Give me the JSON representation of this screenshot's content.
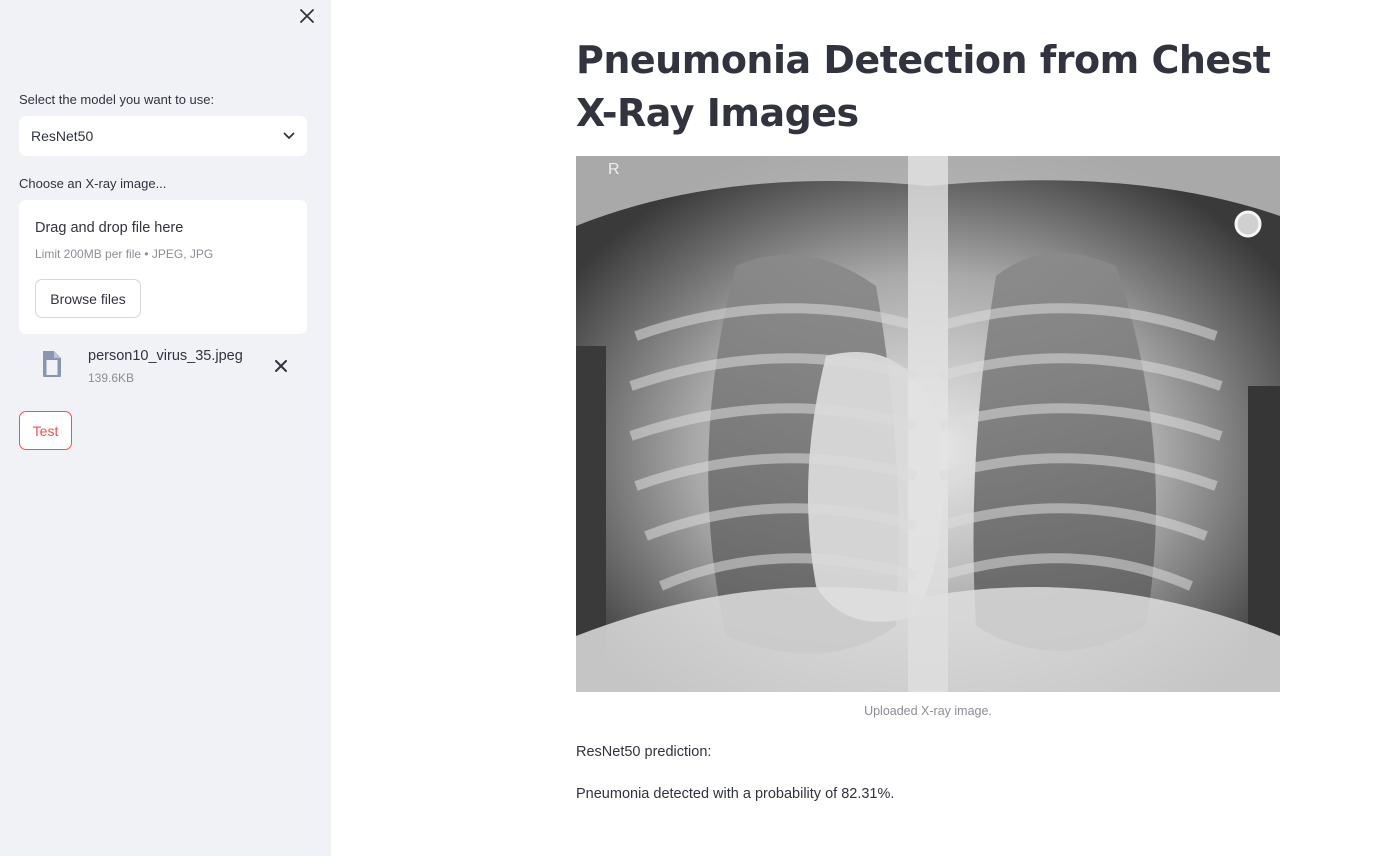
{
  "sidebar": {
    "model_label": "Select the model you want to use:",
    "model_selected": "ResNet50",
    "upload_label": "Choose an X-ray image...",
    "uploader": {
      "drop_title": "Drag and drop file here",
      "drop_subtitle": "Limit 200MB per file • JPEG, JPG",
      "browse_label": "Browse files"
    },
    "file": {
      "name": "person10_virus_35.jpeg",
      "size": "139.6KB"
    },
    "test_label": "Test"
  },
  "main": {
    "title": "Pneumonia Detection from Chest X-Ray Images",
    "image": {
      "marker": "R",
      "caption": "Uploaded X-ray image."
    },
    "prediction_title": "ResNet50 prediction:",
    "prediction_result": "Pneumonia detected with a probability of 82.31%."
  },
  "colors": {
    "sidebar_bg": "#f0f2f6",
    "text": "#31333f",
    "muted": "#8c8e96",
    "accent": "#ff4b4b"
  },
  "icons": {
    "sidebar_close": "close-icon",
    "select_arrow": "chevron-down-icon",
    "file": "file-icon",
    "file_remove": "close-icon"
  }
}
